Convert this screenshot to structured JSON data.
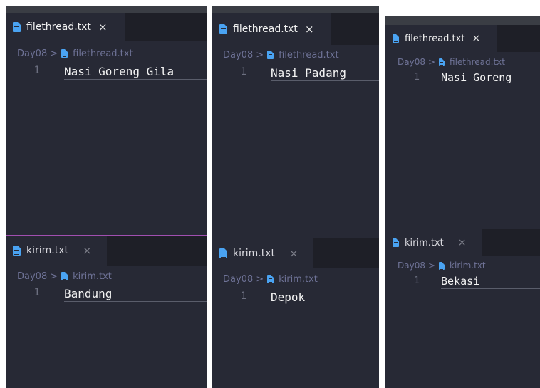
{
  "panels": [
    {
      "top": {
        "tab": "filethread.txt",
        "close": "×",
        "breadcrumb": {
          "folder": "Day08",
          "separator": ">",
          "file": "filethread.txt"
        },
        "line_number": "1",
        "line_text": "Nasi Goreng Gila"
      },
      "bottom": {
        "tab": "kirim.txt",
        "close": "×",
        "breadcrumb": {
          "folder": "Day08",
          "separator": ">",
          "file": "kirim.txt"
        },
        "line_number": "1",
        "line_text": "Bandung"
      }
    },
    {
      "top": {
        "tab": "filethread.txt",
        "close": "×",
        "breadcrumb": {
          "folder": "Day08",
          "separator": ">",
          "file": "filethread.txt"
        },
        "line_number": "1",
        "line_text": "Nasi Padang"
      },
      "bottom": {
        "tab": "kirim.txt",
        "close": "×",
        "breadcrumb": {
          "folder": "Day08",
          "separator": ">",
          "file": "kirim.txt"
        },
        "line_number": "1",
        "line_text": "Depok"
      }
    },
    {
      "top": {
        "tab": "filethread.txt",
        "close": "×",
        "breadcrumb": {
          "folder": "Day08",
          "separator": ">",
          "file": "filethread.txt"
        },
        "line_number": "1",
        "line_text": "Nasi Goreng"
      },
      "bottom": {
        "tab": "kirim.txt",
        "close": "×",
        "breadcrumb": {
          "folder": "Day08",
          "separator": ">",
          "file": "kirim.txt"
        },
        "line_number": "1",
        "line_text": "Bekasi"
      }
    }
  ],
  "colors": {
    "editor_bg": "#272935",
    "tabbar_bg": "#1e1f27",
    "file_icon": "#4aa3f2",
    "breadcrumb_text": "#6e7296",
    "split_border": "#a14fb0",
    "line_number": "#6c6f80"
  },
  "icons": {
    "file": "file-text-icon",
    "close": "close-icon",
    "breadcrumb_separator": "chevron-right-icon"
  }
}
